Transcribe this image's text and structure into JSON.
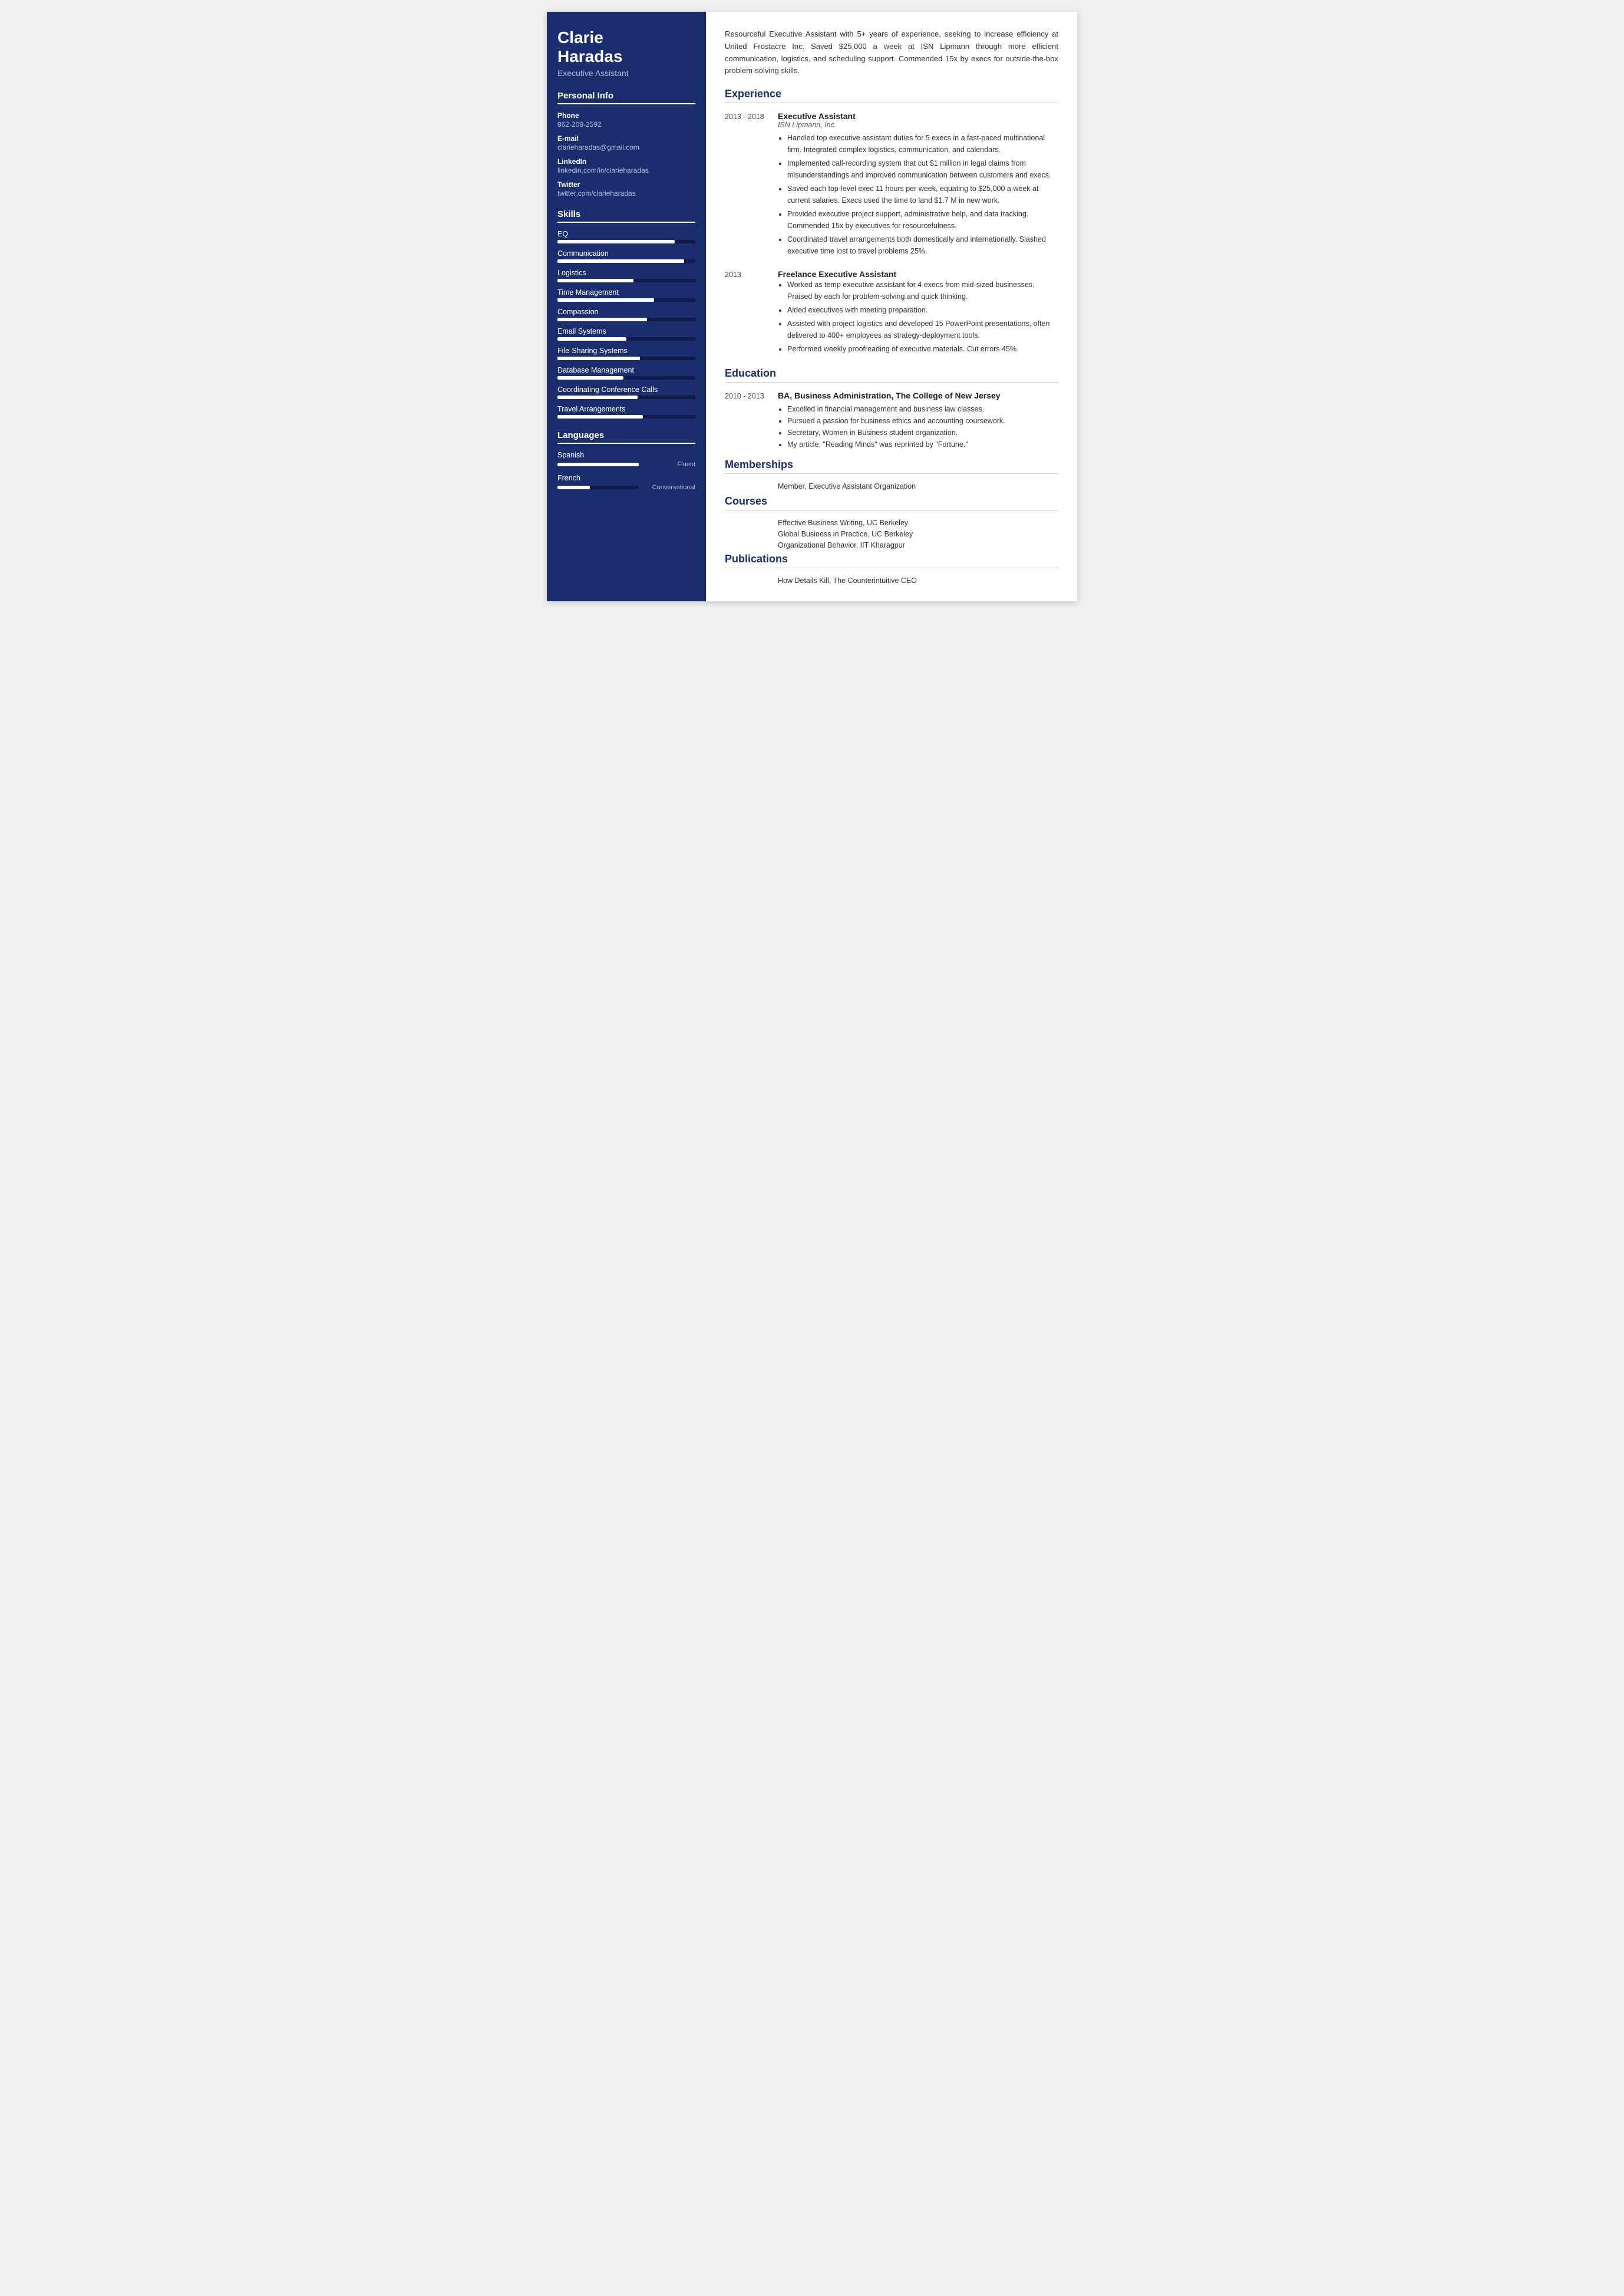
{
  "sidebar": {
    "name": "Clarie\nHaradas",
    "name_line1": "Clarie",
    "name_line2": "Haradas",
    "title": "Executive Assistant",
    "personal_info_label": "Personal Info",
    "phone_label": "Phone",
    "phone_value": "862-208-2592",
    "email_label": "E-mail",
    "email_value": "clarieharadas@gmail.com",
    "linkedin_label": "LinkedIn",
    "linkedin_value": "linkedin.com/in/clarieharadas",
    "twitter_label": "Twitter",
    "twitter_value": "twitter.com/clarieharadas",
    "skills_label": "Skills",
    "skills": [
      {
        "name": "EQ",
        "pct": 85
      },
      {
        "name": "Communication",
        "pct": 92
      },
      {
        "name": "Logistics",
        "pct": 55
      },
      {
        "name": "Time Management",
        "pct": 70
      },
      {
        "name": "Compassion",
        "pct": 65
      },
      {
        "name": "Email Systems",
        "pct": 50
      },
      {
        "name": "File-Sharing Systems",
        "pct": 60
      },
      {
        "name": "Database Management",
        "pct": 48
      },
      {
        "name": "Coordinating Conference Calls",
        "pct": 58
      },
      {
        "name": "Travel Arrangements",
        "pct": 62
      }
    ],
    "languages_label": "Languages",
    "languages": [
      {
        "name": "Spanish",
        "pct": 100,
        "level": "Fluent"
      },
      {
        "name": "French",
        "pct": 40,
        "level": "Conversational"
      }
    ]
  },
  "main": {
    "summary": "Resourceful Executive Assistant with 5+ years of experience, seeking to increase efficiency at United Frostacre Inc. Saved $25,000 a week at ISN Lipmann through more efficient communication, logistics, and scheduling support. Commended 15x by execs for outside-the-box problem-solving skills.",
    "experience_label": "Experience",
    "experience": [
      {
        "dates": "2013 - 2018",
        "job_title": "Executive Assistant",
        "company": "ISN Lipmann, Inc.",
        "bullets": [
          "Handled top executive assistant duties for 5 execs in a fast-paced multinational firm. Integrated complex logistics, communication, and calendars.",
          "Implemented call-recording system that cut $1 million in legal claims from misunderstandings and improved communication between customers and execs.",
          "Saved each top-level exec 11 hours per week, equating to $25,000 a week at current salaries. Execs used the time to land $1.7 M in new work.",
          "Provided executive project support, administrative help, and data tracking. Commended 15x by executives for resourcefulness.",
          "Coordinated travel arrangements both domestically and internationally. Slashed executive time lost to travel problems 25%."
        ]
      },
      {
        "dates": "2013",
        "job_title": "Freelance Executive Assistant",
        "company": "",
        "bullets": [
          "Worked as temp executive assistant for 4 execs from mid-sized businesses. Praised by each for problem-solving and quick thinking.",
          "Aided executives with meeting preparation.",
          "Assisted with project logistics and developed 15 PowerPoint presentations, often delivered to 400+ employees as strategy-deployment tools.",
          "Performed weekly proofreading of executive materials. Cut errors 45%."
        ]
      }
    ],
    "education_label": "Education",
    "education": [
      {
        "dates": "2010 - 2013",
        "degree": "BA, Business Administration, The College of New Jersey",
        "bullets": [
          "Excelled in financial management and business law classes.",
          "Pursued a passion for business ethics and accounting coursework.",
          "Secretary, Women in Business student organization.",
          "My article, \"Reading Minds\" was reprinted by \"Fortune.\""
        ]
      }
    ],
    "memberships_label": "Memberships",
    "memberships": [
      "Member, Executive Assistant Organization"
    ],
    "courses_label": "Courses",
    "courses": [
      "Effective Business Writing, UC Berkeley",
      "Global Business in Practice, UC Berkeley",
      "Organizational Behavior, IIT Kharagpur"
    ],
    "publications_label": "Publications",
    "publications": [
      "How Details Kill, The Counterintuitive CEO"
    ]
  }
}
